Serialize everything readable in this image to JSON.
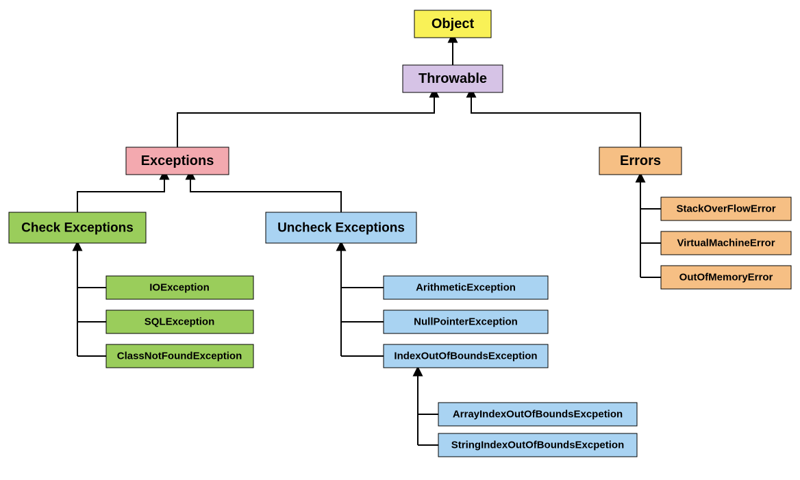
{
  "chart_data": {
    "type": "tree",
    "title": "",
    "hierarchy": {
      "Object": {
        "Throwable": {
          "Exceptions": {
            "Check Exceptions": [
              "IOException",
              "SQLException",
              "ClassNotFoundException"
            ],
            "Uncheck Exceptions": {
              "ArithmeticException": [],
              "NullPointerException": [],
              "IndexOutOfBoundsException": [
                "ArrayIndexOutOfBoundsExcpetion",
                "StringIndexOutOfBoundsExcpetion"
              ]
            }
          },
          "Errors": [
            "StackOverFlowError",
            "VirtualMachineError",
            "OutOfMemoryError"
          ]
        }
      }
    }
  },
  "colors": {
    "object": "#F9F157",
    "throwable": "#D6C3E6",
    "exceptions": "#F3A9AF",
    "errors": "#F6BF84",
    "check": "#9ACD5B",
    "uncheck": "#A9D3F2"
  },
  "nodes": {
    "object": "Object",
    "throwable": "Throwable",
    "exceptions": "Exceptions",
    "errors": "Errors",
    "check": "Check Exceptions",
    "uncheck": "Uncheck Exceptions",
    "io": "IOException",
    "sql": "SQLException",
    "cnf": "ClassNotFoundException",
    "arith": "ArithmeticException",
    "npe": "NullPointerException",
    "ioob": "IndexOutOfBoundsException",
    "aioob": "ArrayIndexOutOfBoundsExcpetion",
    "sioob": "StringIndexOutOfBoundsExcpetion",
    "sof": "StackOverFlowError",
    "vme": "VirtualMachineError",
    "oom": "OutOfMemoryError"
  }
}
